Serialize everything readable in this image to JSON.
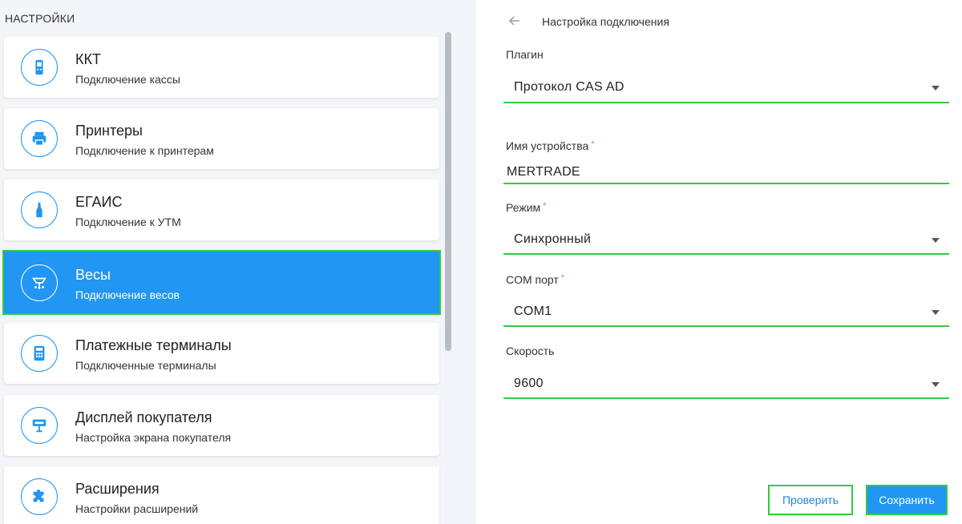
{
  "sidebar": {
    "title": "НАСТРОЙКИ",
    "items": [
      {
        "title": "ККТ",
        "subtitle": "Подключение кассы",
        "icon": "cash-register-icon"
      },
      {
        "title": "Принтеры",
        "subtitle": "Подключение к принтерам",
        "icon": "printer-icon"
      },
      {
        "title": "ЕГАИС",
        "subtitle": "Подключение к УТМ",
        "icon": "bottle-icon"
      },
      {
        "title": "Весы",
        "subtitle": "Подключение весов",
        "icon": "scales-icon"
      },
      {
        "title": "Платежные терминалы",
        "subtitle": "Подключенные терминалы",
        "icon": "calculator-icon"
      },
      {
        "title": "Дисплей покупателя",
        "subtitle": "Настройка экрана покупателя",
        "icon": "display-icon"
      },
      {
        "title": "Расширения",
        "subtitle": "Настройки расширений",
        "icon": "puzzle-icon"
      }
    ]
  },
  "form": {
    "title": "Настройка подключения",
    "plugin": {
      "label": "Плагин",
      "value": "Протокол CAS AD"
    },
    "device_name": {
      "label": "Имя устройства",
      "required": "*",
      "value": "MERTRADE"
    },
    "mode": {
      "label": "Режим",
      "required": "*",
      "value": "Синхронный"
    },
    "com_port": {
      "label": "COM порт",
      "required": "*",
      "value": "COM1"
    },
    "speed": {
      "label": "Скорость",
      "value": "9600"
    },
    "check_label": "Проверить",
    "save_label": "Сохранить"
  },
  "colors": {
    "accent": "#2196f3",
    "highlight": "#2ecc40"
  }
}
